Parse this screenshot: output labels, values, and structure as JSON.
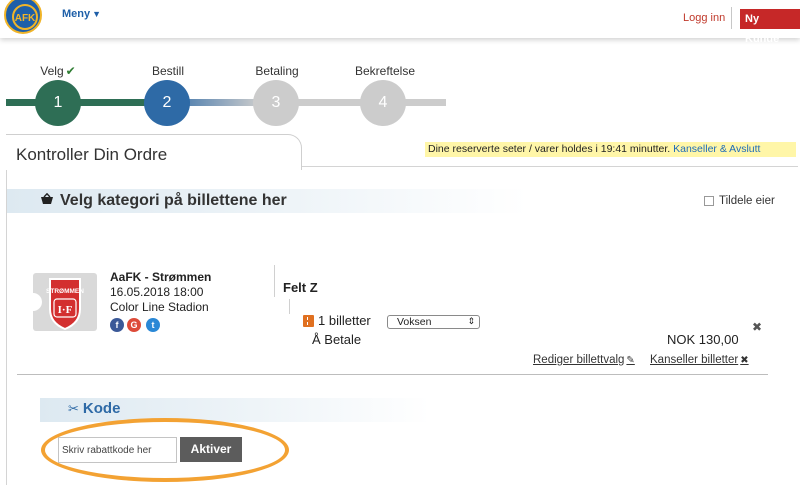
{
  "header": {
    "menu_label": "Meny",
    "login_label": "Logg inn",
    "new_customer_label": "Ny Kunde"
  },
  "steps": [
    {
      "label": "Velg",
      "number": "1",
      "done": true,
      "color": "#2e6e55"
    },
    {
      "label": "Bestill",
      "number": "2",
      "done": false,
      "color": "#2e6aa6"
    },
    {
      "label": "Betaling",
      "number": "3",
      "done": false,
      "color": "#cccccc"
    },
    {
      "label": "Bekreftelse",
      "number": "4",
      "done": false,
      "color": "#cccccc"
    }
  ],
  "order": {
    "title": "Kontroller Din Ordre",
    "reservation_note": "Dine reserverte seter / varer holdes i 19:41 minutter.",
    "cancel_and_exit": "Kanseller & Avslutt"
  },
  "category": {
    "title": "Velg kategori på billettene her",
    "assign_owner_label": "Tildele eier",
    "assign_owner_checked": false
  },
  "event": {
    "name": "AaFK - Strømmen",
    "datetime": "16.05.2018 18:00",
    "venue": "Color Line Stadion",
    "badge_text": "STRØMMEN",
    "badge_initials": "I·F",
    "social": [
      "facebook-icon",
      "google-plus-icon",
      "twitter-icon"
    ]
  },
  "ticket": {
    "section": "Felt Z",
    "count_label": "1 billetter",
    "type_selected": "Voksen",
    "to_pay_label": "Å Betale",
    "price": "NOK 130,00",
    "edit_label": "Rediger billettvalg",
    "cancel_label": "Kanseller billetter"
  },
  "code": {
    "title": "Kode",
    "placeholder": "Skriv rabattkode her",
    "activate_label": "Aktiver"
  },
  "colors": {
    "accent_blue": "#1e6bb8",
    "brand_red": "#c62828",
    "highlight_orange": "#f3a233",
    "reservation_yellow": "#fff6a8"
  }
}
